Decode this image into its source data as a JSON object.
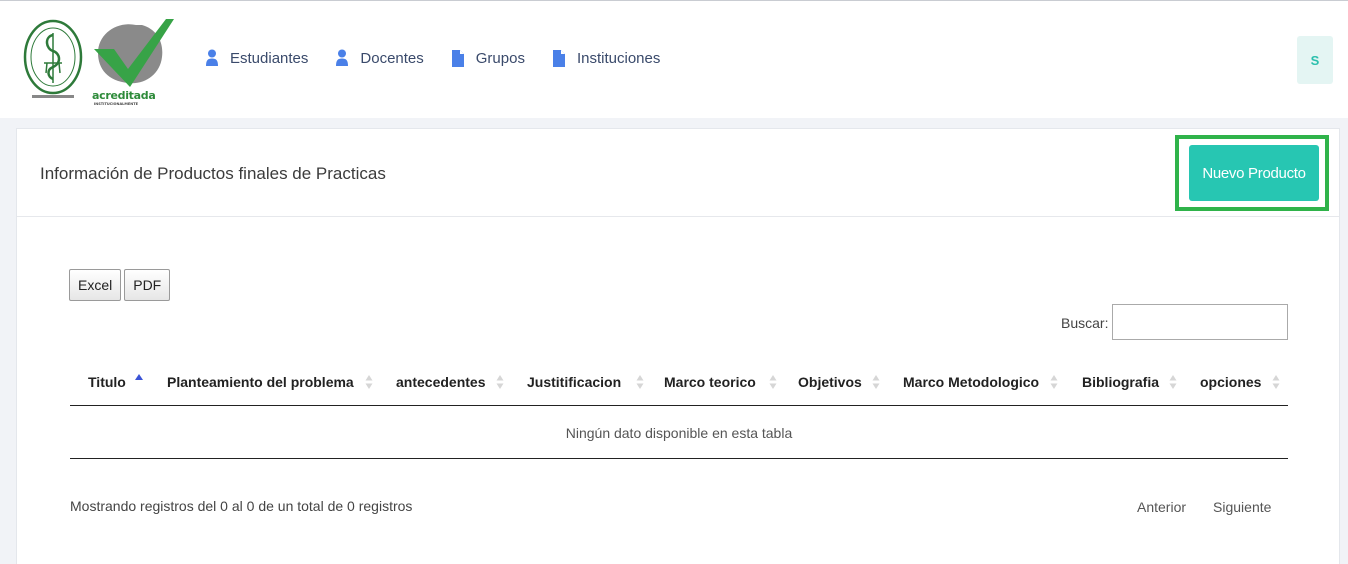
{
  "logos": {
    "acreditada_text": "acreditada",
    "acreditada_sub": "INSTITUCIONALMENTE"
  },
  "nav": {
    "items": [
      {
        "label": "Estudiantes",
        "icon": "user-icon"
      },
      {
        "label": "Docentes",
        "icon": "user-icon"
      },
      {
        "label": "Grupos",
        "icon": "file-icon"
      },
      {
        "label": "Instituciones",
        "icon": "file-icon"
      }
    ]
  },
  "user": {
    "initial": "S"
  },
  "card": {
    "title": "Información de Productos finales de Practicas",
    "new_button": "Nuevo Producto"
  },
  "export": {
    "excel": "Excel",
    "pdf": "PDF"
  },
  "search": {
    "label": "Buscar:",
    "value": ""
  },
  "table": {
    "columns": [
      "Titulo",
      "Planteamiento del problema",
      "antecedentes",
      "Justitificacion",
      "Marco teorico",
      "Objetivos",
      "Marco Metodologico",
      "Bibliografia",
      "opciones"
    ],
    "empty_message": "Ningún dato disponible en esta tabla"
  },
  "footer": {
    "info": "Mostrando registros del 0 al 0 de un total de 0 registros",
    "prev": "Anterior",
    "next": "Siguiente"
  },
  "colors": {
    "accent": "#27c6b2",
    "highlight_outline": "#2fb34a",
    "nav_icon": "#4a80e8",
    "nav_text": "#3a4a6b"
  }
}
